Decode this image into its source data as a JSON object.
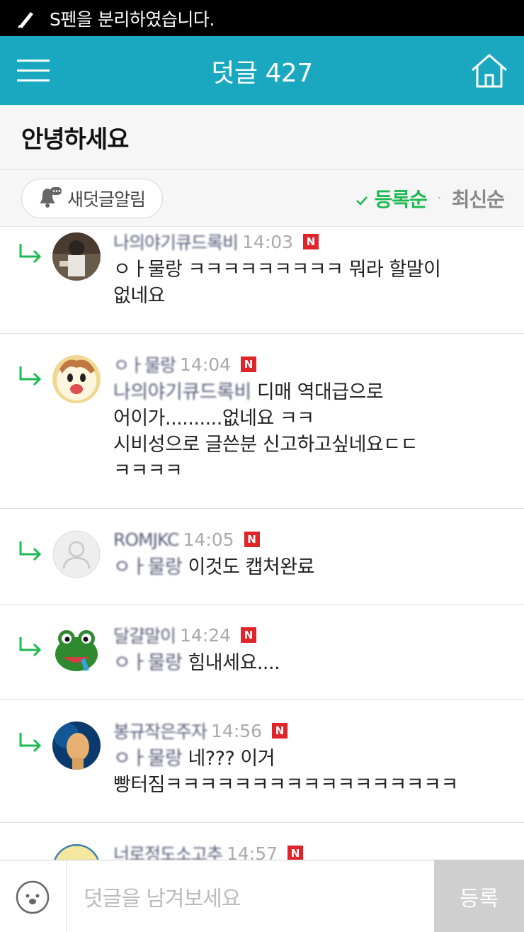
{
  "status_bar": {
    "text": "S펜을 분리하였습니다."
  },
  "header": {
    "title": "덧글 427"
  },
  "article": {
    "title": "안녕하세요"
  },
  "toolbar": {
    "notify_label": "새덧글알림",
    "sort_registered": "등록순",
    "sort_latest": "최신순"
  },
  "comments": [
    {
      "nick": "나의야기큐드록비",
      "time": "14:03",
      "badge": "N",
      "mention": "",
      "text": "ㅇㅏ물랑 ㅋㅋㅋㅋㅋㅋㅋㅋㅋ 뭐라 할말이",
      "text2": "없네요",
      "text3": "",
      "text4": ""
    },
    {
      "nick": "ㅇㅏ물랑",
      "time": "14:04",
      "badge": "N",
      "mention": "나의야기큐드록비",
      "text": " 디매 역대급으로",
      "text2": "어이가..........없네요 ㅋㅋ",
      "text3": "시비성으로 글쓴분 신고하고싶네요ㄷㄷ",
      "text4": "ㅋㅋㅋㅋ"
    },
    {
      "nick": "ROMJKC",
      "time": "14:05",
      "badge": "N",
      "mention": "ㅇㅏ물랑",
      "text": " 이것도 캡처완료",
      "text2": "",
      "text3": "",
      "text4": ""
    },
    {
      "nick": "달걀말이",
      "time": "14:24",
      "badge": "N",
      "mention": "ㅇㅏ물랑",
      "text": " 힘내세요....",
      "text2": "",
      "text3": "",
      "text4": ""
    },
    {
      "nick": "봉규작은주자",
      "time": "14:56",
      "badge": "N",
      "mention": "ㅇㅏ물랑",
      "text": " 네??? 이거",
      "text2": "빵터짐ㅋㅋㅋㅋㅋㅋㅋㅋㅋㅋㅋㅋㅋㅋㅋㅋㅋ",
      "text3": "",
      "text4": ""
    },
    {
      "nick": "너로정도소고추",
      "time": "14:57",
      "badge": "N",
      "mention": "",
      "text": "",
      "text2": "",
      "text3": "",
      "text4": ""
    }
  ],
  "input": {
    "placeholder": "덧글을 남겨보세요",
    "submit_label": "등록"
  },
  "colors": {
    "header_bg": "#1aa8c0",
    "accent_green": "#1db954",
    "badge_red": "#e0252a"
  }
}
